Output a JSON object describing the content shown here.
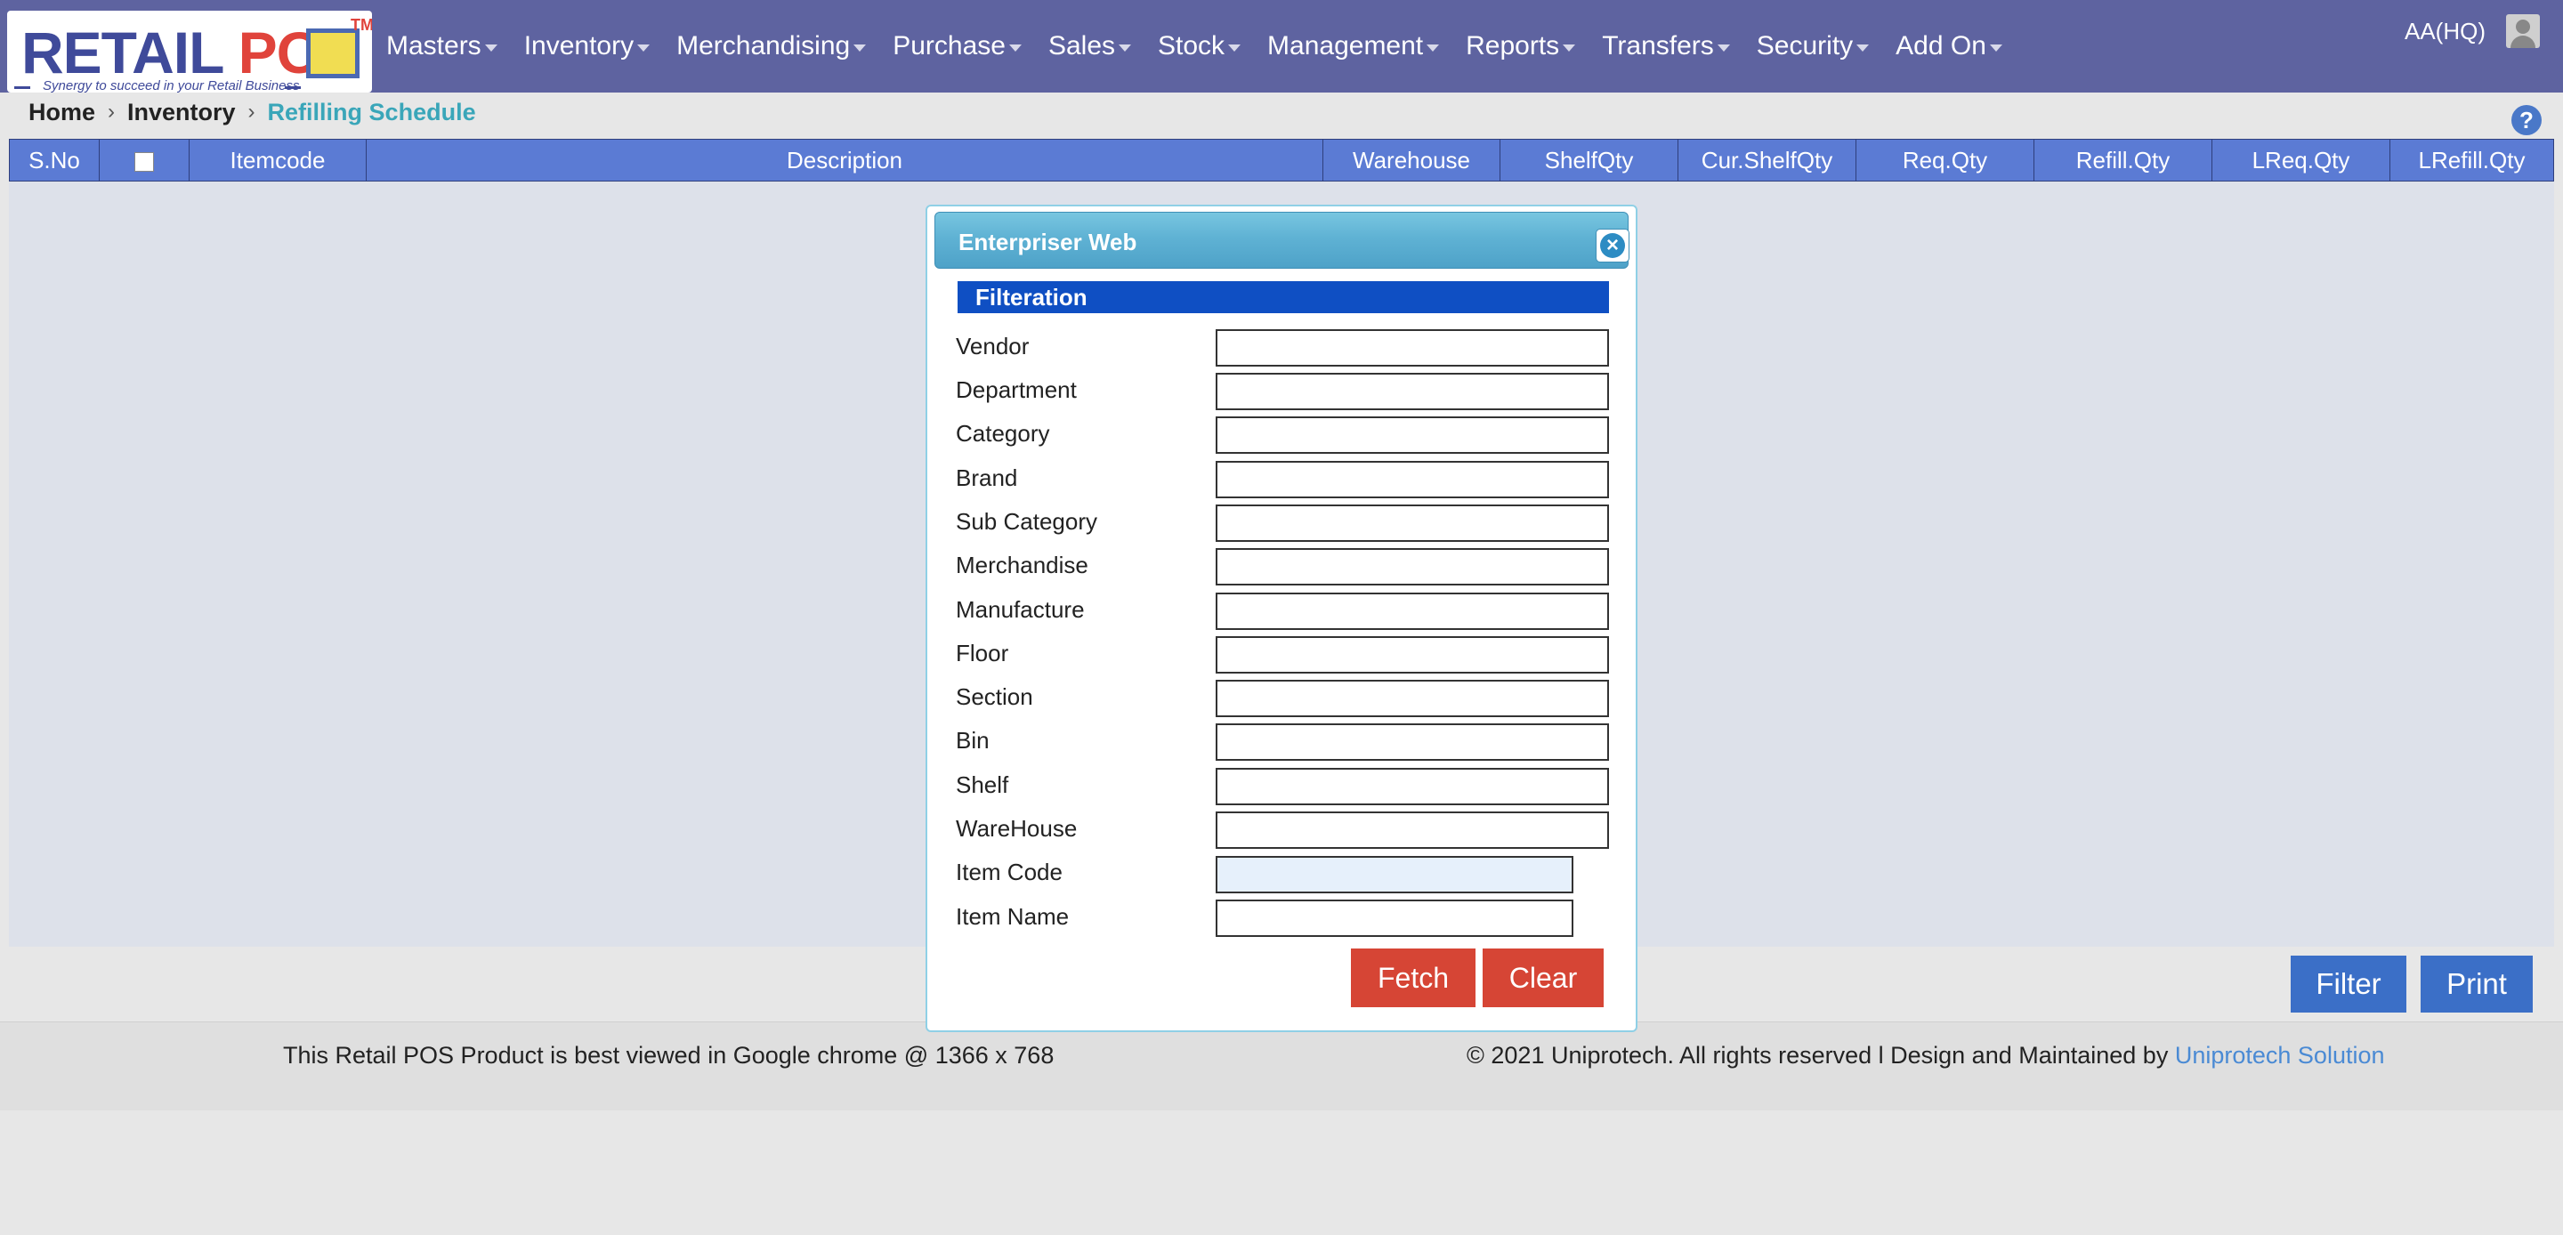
{
  "logo": {
    "brand_a": "RETAIL",
    "brand_b": "POS",
    "tm": "TM",
    "tagline": "Synergy to succeed in your Retail Business"
  },
  "nav": {
    "items": [
      {
        "label": "Masters"
      },
      {
        "label": "Inventory"
      },
      {
        "label": "Merchandising"
      },
      {
        "label": "Purchase"
      },
      {
        "label": "Sales"
      },
      {
        "label": "Stock"
      },
      {
        "label": "Management"
      },
      {
        "label": "Reports"
      },
      {
        "label": "Transfers"
      },
      {
        "label": "Security"
      },
      {
        "label": "Add On"
      }
    ],
    "user": "AA(HQ)"
  },
  "breadcrumb": {
    "home": "Home",
    "section": "Inventory",
    "current": "Refilling Schedule",
    "separator": "›"
  },
  "help": "?",
  "grid": {
    "columns": [
      {
        "label": "S.No"
      },
      {
        "label": ""
      },
      {
        "label": "Itemcode"
      },
      {
        "label": "Description"
      },
      {
        "label": "Warehouse"
      },
      {
        "label": "ShelfQty"
      },
      {
        "label": "Cur.ShelfQty"
      },
      {
        "label": "Req.Qty"
      },
      {
        "label": "Refill.Qty"
      },
      {
        "label": "LReq.Qty"
      },
      {
        "label": "LRefill.Qty"
      }
    ]
  },
  "actions": {
    "filter": "Filter",
    "print": "Print"
  },
  "footer": {
    "left": "This Retail POS Product is best viewed in Google chrome @ 1366 x 768",
    "right": "© 2021 Uniprotech. All rights reserved l Design and Maintained by",
    "link": "Uniprotech Solution"
  },
  "dialog": {
    "title": "Enterpriser Web",
    "close": "×",
    "section": "Filteration",
    "fields": [
      {
        "label": "Vendor",
        "value": ""
      },
      {
        "label": "Department",
        "value": ""
      },
      {
        "label": "Category",
        "value": ""
      },
      {
        "label": "Brand",
        "value": ""
      },
      {
        "label": "Sub Category",
        "value": ""
      },
      {
        "label": "Merchandise",
        "value": ""
      },
      {
        "label": "Manufacture",
        "value": ""
      },
      {
        "label": "Floor",
        "value": ""
      },
      {
        "label": "Section",
        "value": ""
      },
      {
        "label": "Bin",
        "value": ""
      },
      {
        "label": "Shelf",
        "value": ""
      },
      {
        "label": "WareHouse",
        "value": ""
      },
      {
        "label": "Item Code",
        "value": ""
      },
      {
        "label": "Item Name",
        "value": ""
      }
    ],
    "fetch": "Fetch",
    "clear": "Clear"
  },
  "colors": {
    "navbar": "#5e63a0",
    "grid_header": "#5b7bd4",
    "section_bar": "#0f4fc3",
    "button_blue": "#3b6fc7",
    "button_red": "#d64535",
    "breadcrumb_active": "#3aa6b9"
  }
}
